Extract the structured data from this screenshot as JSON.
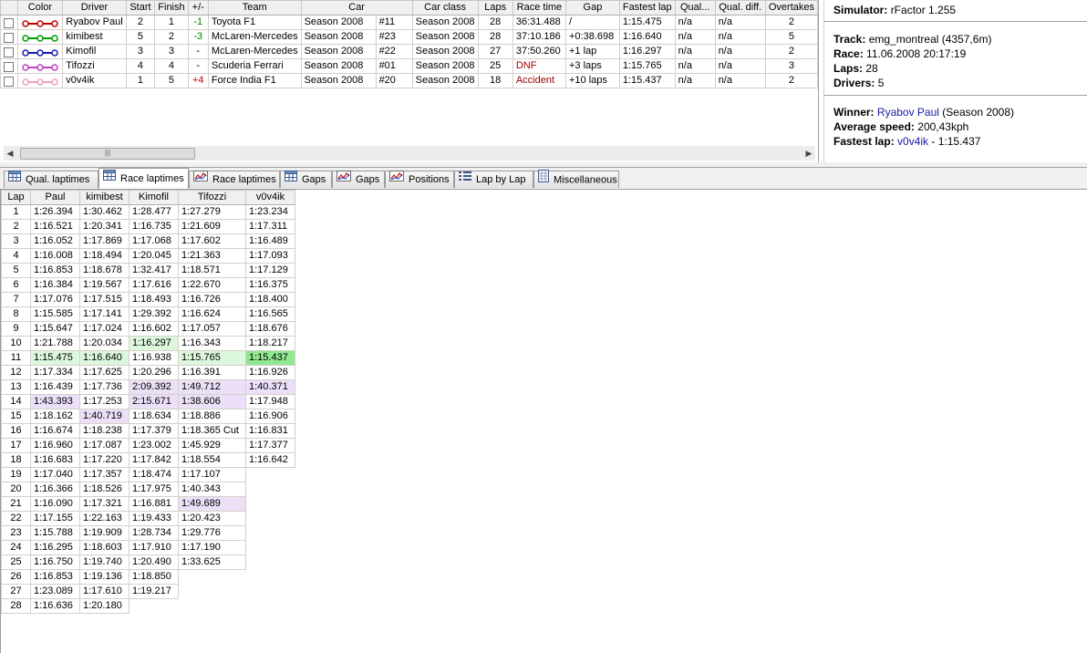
{
  "results": {
    "columns": [
      "Color",
      "Driver",
      "Start",
      "Finish",
      "+/-",
      "Team",
      "Car",
      "Car class",
      "Laps",
      "Race time",
      "Gap",
      "Fastest lap",
      "Qual...",
      "Qual. diff.",
      "Overtakes"
    ],
    "rows": [
      {
        "color": "#c00000",
        "driver": "Ryabov Paul",
        "start": "2",
        "finish": "1",
        "diff": "-1",
        "diff_type": "pos",
        "team": "Toyota F1",
        "car_name": "Season 2008",
        "car_no": "#11",
        "car_class": "Season 2008",
        "laps": "28",
        "race_time": "36:31.488",
        "race_time_type": "normal",
        "gap": "/",
        "fastest": "1:15.475",
        "qual": "n/a",
        "qual_diff": "n/a",
        "overtakes": "2"
      },
      {
        "color": "#00a000",
        "driver": "kimibest",
        "start": "5",
        "finish": "2",
        "diff": "-3",
        "diff_type": "pos",
        "team": "McLaren-Mercedes",
        "car_name": "Season 2008",
        "car_no": "#23",
        "car_class": "Season 2008",
        "laps": "28",
        "race_time": "37:10.186",
        "race_time_type": "normal",
        "gap": "+0:38.698",
        "fastest": "1:16.640",
        "qual": "n/a",
        "qual_diff": "n/a",
        "overtakes": "5"
      },
      {
        "color": "#1a1ab0",
        "driver": "Kimofil",
        "start": "3",
        "finish": "3",
        "diff": "-",
        "diff_type": "none",
        "team": "McLaren-Mercedes",
        "car_name": "Season 2008",
        "car_no": "#22",
        "car_class": "Season 2008",
        "laps": "27",
        "race_time": "37:50.260",
        "race_time_type": "normal",
        "gap": "+1 lap",
        "fastest": "1:16.297",
        "qual": "n/a",
        "qual_diff": "n/a",
        "overtakes": "2"
      },
      {
        "color": "#c040c0",
        "driver": "Tifozzi",
        "start": "4",
        "finish": "4",
        "diff": "-",
        "diff_type": "none",
        "team": "Scuderia Ferrari",
        "car_name": "Season 2008",
        "car_no": "#01",
        "car_class": "Season 2008",
        "laps": "25",
        "race_time": "DNF",
        "race_time_type": "red",
        "gap": "+3 laps",
        "fastest": "1:15.765",
        "qual": "n/a",
        "qual_diff": "n/a",
        "overtakes": "3"
      },
      {
        "color": "#f0a0c0",
        "driver": "v0v4ik",
        "start": "1",
        "finish": "5",
        "diff": "+4",
        "diff_type": "neg",
        "team": "Force India F1",
        "car_name": "Season 2008",
        "car_no": "#20",
        "car_class": "Season 2008",
        "laps": "18",
        "race_time": "Accident",
        "race_time_type": "red",
        "gap": "+10 laps",
        "fastest": "1:15.437",
        "qual": "n/a",
        "qual_diff": "n/a",
        "overtakes": "2"
      }
    ]
  },
  "info": {
    "simulator_label": "Simulator:",
    "simulator": "rFactor 1.255",
    "track_label": "Track:",
    "track": "emg_montreal (4357,6m)",
    "race_label": "Race:",
    "race": "11.06.2008 20:17:19",
    "laps_label": "Laps:",
    "laps": "28",
    "drivers_label": "Drivers:",
    "drivers": "5",
    "winner_label": "Winner:",
    "winner": "Ryabov Paul",
    "winner_extra": "(Season 2008)",
    "avg_speed_label": "Average speed:",
    "avg_speed": "200,43kph",
    "fastest_lap_label": "Fastest lap:",
    "fastest_lap_driver": "v0v4ik",
    "fastest_lap_time": "- 1:15.437"
  },
  "tabs": [
    {
      "label": "Qual. laptimes",
      "icon": "table-icon",
      "active": false
    },
    {
      "label": "Race laptimes",
      "icon": "table-icon",
      "active": true
    },
    {
      "label": "Race laptimes",
      "icon": "line-chart-icon",
      "active": false
    },
    {
      "label": "Gaps",
      "icon": "table-icon",
      "active": false
    },
    {
      "label": "Gaps",
      "icon": "line-chart-icon",
      "active": false
    },
    {
      "label": "Positions",
      "icon": "line-chart-icon",
      "active": false
    },
    {
      "label": "Lap by Lap",
      "icon": "list-icon",
      "active": false
    },
    {
      "label": "Miscellaneous",
      "icon": "grid-icon",
      "active": false
    }
  ],
  "laptimes": {
    "headers": [
      "Lap",
      "Paul",
      "kimibest",
      "Kimofil",
      "Tifozzi",
      "v0v4ik"
    ],
    "rows": [
      [
        "1",
        "1:26.394",
        "1:30.462",
        "1:28.477",
        "1:27.279",
        "1:23.234"
      ],
      [
        "2",
        "1:16.521",
        "1:20.341",
        "1:16.735",
        "1:21.609",
        "1:17.311"
      ],
      [
        "3",
        "1:16.052",
        "1:17.869",
        "1:17.068",
        "1:17.602",
        "1:16.489"
      ],
      [
        "4",
        "1:16.008",
        "1:18.494",
        "1:20.045",
        "1:21.363",
        "1:17.093"
      ],
      [
        "5",
        "1:16.853",
        "1:18.678",
        "1:32.417",
        "1:18.571",
        "1:17.129"
      ],
      [
        "6",
        "1:16.384",
        "1:19.567",
        "1:17.616",
        "1:22.670",
        "1:16.375"
      ],
      [
        "7",
        "1:17.076",
        "1:17.515",
        "1:18.493",
        "1:16.726",
        "1:18.400"
      ],
      [
        "8",
        "1:15.585",
        "1:17.141",
        "1:29.392",
        "1:16.624",
        "1:16.565"
      ],
      [
        "9",
        "1:15.647",
        "1:17.024",
        "1:16.602",
        "1:17.057",
        "1:18.676"
      ],
      [
        "10",
        "1:21.788",
        "1:20.034",
        "1:16.297",
        "1:16.343",
        "1:18.217"
      ],
      [
        "11",
        "1:15.475",
        "1:16.640",
        "1:16.938",
        "1:15.765",
        "1:15.437"
      ],
      [
        "12",
        "1:17.334",
        "1:17.625",
        "1:20.296",
        "1:16.391",
        "1:16.926"
      ],
      [
        "13",
        "1:16.439",
        "1:17.736",
        "2:09.392",
        "1:49.712",
        "1:40.371"
      ],
      [
        "14",
        "1:43.393",
        "1:17.253",
        "2:15.671",
        "1:38.606",
        "1:17.948"
      ],
      [
        "15",
        "1:18.162",
        "1:40.719",
        "1:18.634",
        "1:18.886",
        "1:16.906"
      ],
      [
        "16",
        "1:16.674",
        "1:18.238",
        "1:17.379",
        "1:18.365 Cut",
        "1:16.831"
      ],
      [
        "17",
        "1:16.960",
        "1:17.087",
        "1:23.002",
        "1:45.929",
        "1:17.377"
      ],
      [
        "18",
        "1:16.683",
        "1:17.220",
        "1:17.842",
        "1:18.554",
        "1:16.642"
      ],
      [
        "19",
        "1:17.040",
        "1:17.357",
        "1:18.474",
        "1:17.107",
        ""
      ],
      [
        "20",
        "1:16.366",
        "1:18.526",
        "1:17.975",
        "1:40.343",
        ""
      ],
      [
        "21",
        "1:16.090",
        "1:17.321",
        "1:16.881",
        "1:49.689",
        ""
      ],
      [
        "22",
        "1:17.155",
        "1:22.163",
        "1:19.433",
        "1:20.423",
        ""
      ],
      [
        "23",
        "1:15.788",
        "1:19.909",
        "1:28.734",
        "1:29.776",
        ""
      ],
      [
        "24",
        "1:16.295",
        "1:18.603",
        "1:17.910",
        "1:17.190",
        ""
      ],
      [
        "25",
        "1:16.750",
        "1:19.740",
        "1:20.490",
        "1:33.625",
        ""
      ],
      [
        "26",
        "1:16.853",
        "1:19.136",
        "1:18.850",
        "",
        ""
      ],
      [
        "27",
        "1:23.089",
        "1:17.610",
        "1:19.217",
        "",
        ""
      ],
      [
        "28",
        "1:16.636",
        "1:20.180",
        "",
        "",
        ""
      ]
    ],
    "highlights": [
      {
        "row": 10,
        "col": 1,
        "type": "good"
      },
      {
        "row": 10,
        "col": 2,
        "type": "good"
      },
      {
        "row": 10,
        "col": 4,
        "type": "good"
      },
      {
        "row": 10,
        "col": 5,
        "type": "best"
      },
      {
        "row": 9,
        "col": 3,
        "type": "good"
      },
      {
        "row": 12,
        "col": 3,
        "type": "slow"
      },
      {
        "row": 12,
        "col": 4,
        "type": "slow"
      },
      {
        "row": 12,
        "col": 5,
        "type": "slow"
      },
      {
        "row": 13,
        "col": 1,
        "type": "slow"
      },
      {
        "row": 13,
        "col": 3,
        "type": "slow"
      },
      {
        "row": 13,
        "col": 4,
        "type": "slow"
      },
      {
        "row": 14,
        "col": 2,
        "type": "slow"
      },
      {
        "row": 20,
        "col": 4,
        "type": "slow"
      }
    ]
  }
}
